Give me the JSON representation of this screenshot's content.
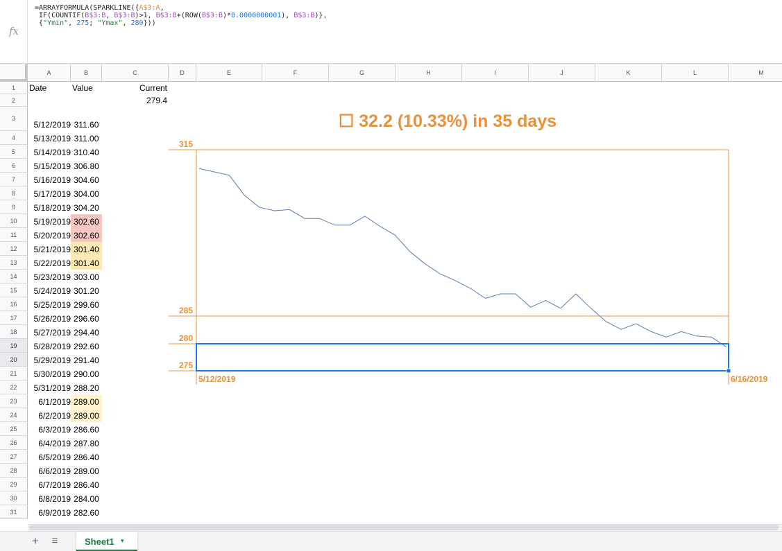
{
  "formula_bar": {
    "fx_label": "fx",
    "line1_prefix": "=ARRAYFORMULA(SPARKLINE({",
    "line1_ref": "A$3:A",
    "line1_suffix": ",",
    "line2_a": " IF(COUNTIF(",
    "line2_ref1": "B$3:B",
    "line2_b": ", ",
    "line2_ref2": "B$3:B",
    "line2_c": ")>1, ",
    "line2_ref3": "B$3:B",
    "line2_d": "+(ROW(",
    "line2_ref4": "B$3:B",
    "line2_e": ")*",
    "line2_num": "0.0000000001",
    "line2_f": "), ",
    "line2_ref5": "B$3:B",
    "line2_g": ")},",
    "line3_a": " {",
    "line3_s1": "\"Ymin\"",
    "line3_b": ", ",
    "line3_n1": "275",
    "line3_c": "; ",
    "line3_s2": "\"Ymax\"",
    "line3_d": ", ",
    "line3_n2": "280",
    "line3_e": "}))"
  },
  "columns": [
    "A",
    "B",
    "C",
    "D",
    "E",
    "F",
    "G",
    "H",
    "I",
    "J",
    "K",
    "L",
    "M"
  ],
  "headers": {
    "date": "Date",
    "value": "Value",
    "current": "Current"
  },
  "current_value": "279.4",
  "rows": [
    {
      "date": "5/12/2019",
      "value": "311.60",
      "hl": ""
    },
    {
      "date": "5/13/2019",
      "value": "311.00",
      "hl": ""
    },
    {
      "date": "5/14/2019",
      "value": "310.40",
      "hl": ""
    },
    {
      "date": "5/15/2019",
      "value": "306.80",
      "hl": ""
    },
    {
      "date": "5/16/2019",
      "value": "304.60",
      "hl": ""
    },
    {
      "date": "5/17/2019",
      "value": "304.00",
      "hl": ""
    },
    {
      "date": "5/18/2019",
      "value": "304.20",
      "hl": ""
    },
    {
      "date": "5/19/2019",
      "value": "302.60",
      "hl": "red"
    },
    {
      "date": "5/20/2019",
      "value": "302.60",
      "hl": "red"
    },
    {
      "date": "5/21/2019",
      "value": "301.40",
      "hl": "orange"
    },
    {
      "date": "5/22/2019",
      "value": "301.40",
      "hl": "orange"
    },
    {
      "date": "5/23/2019",
      "value": "303.00",
      "hl": ""
    },
    {
      "date": "5/24/2019",
      "value": "301.20",
      "hl": ""
    },
    {
      "date": "5/25/2019",
      "value": "299.60",
      "hl": ""
    },
    {
      "date": "5/26/2019",
      "value": "296.60",
      "hl": ""
    },
    {
      "date": "5/27/2019",
      "value": "294.40",
      "hl": ""
    },
    {
      "date": "5/28/2019",
      "value": "292.60",
      "hl": ""
    },
    {
      "date": "5/29/2019",
      "value": "291.40",
      "hl": ""
    },
    {
      "date": "5/30/2019",
      "value": "290.00",
      "hl": ""
    },
    {
      "date": "5/31/2019",
      "value": "288.20",
      "hl": ""
    },
    {
      "date": "6/1/2019",
      "value": "289.00",
      "hl": "yellow"
    },
    {
      "date": "6/2/2019",
      "value": "289.00",
      "hl": "yellow"
    },
    {
      "date": "6/3/2019",
      "value": "286.60",
      "hl": ""
    },
    {
      "date": "6/4/2019",
      "value": "287.80",
      "hl": ""
    },
    {
      "date": "6/5/2019",
      "value": "286.40",
      "hl": ""
    },
    {
      "date": "6/6/2019",
      "value": "289.00",
      "hl": ""
    },
    {
      "date": "6/7/2019",
      "value": "286.40",
      "hl": ""
    },
    {
      "date": "6/8/2019",
      "value": "284.00",
      "hl": ""
    },
    {
      "date": "6/9/2019",
      "value": "282.60",
      "hl": ""
    }
  ],
  "highlight_colors": {
    "red": "#f4c7c3",
    "orange": "#fce8b2",
    "yellow": "#fff2cc"
  },
  "chart": {
    "title": "☐ 32.2 (10.33%) in 35 days",
    "accent_color": "#e8913a",
    "line_color": "#5b7fa8",
    "selection_color": "#1a73e8"
  },
  "chart_data": {
    "type": "line",
    "title": "☐ 32.2 (10.33%) in 35 days",
    "x_tick_labels": [
      "5/12/2019",
      "6/16/2019"
    ],
    "y_tick_labels": [
      "315",
      "285",
      "280",
      "275"
    ],
    "y_segments": [
      {
        "from": 285,
        "to": 315
      },
      {
        "from": 280,
        "to": 285
      },
      {
        "from": 275,
        "to": 280
      }
    ],
    "x": [
      "5/12/2019",
      "5/13/2019",
      "5/14/2019",
      "5/15/2019",
      "5/16/2019",
      "5/17/2019",
      "5/18/2019",
      "5/19/2019",
      "5/20/2019",
      "5/21/2019",
      "5/22/2019",
      "5/23/2019",
      "5/24/2019",
      "5/25/2019",
      "5/26/2019",
      "5/27/2019",
      "5/28/2019",
      "5/29/2019",
      "5/30/2019",
      "5/31/2019",
      "6/1/2019",
      "6/2/2019",
      "6/3/2019",
      "6/4/2019",
      "6/5/2019",
      "6/6/2019",
      "6/7/2019",
      "6/8/2019",
      "6/9/2019",
      "6/10/2019",
      "6/11/2019",
      "6/12/2019",
      "6/13/2019",
      "6/14/2019",
      "6/15/2019",
      "6/16/2019"
    ],
    "values": [
      311.6,
      311.0,
      310.4,
      306.8,
      304.6,
      304.0,
      304.2,
      302.6,
      302.6,
      301.4,
      301.4,
      303.0,
      301.2,
      299.6,
      296.6,
      294.4,
      292.6,
      291.4,
      290.0,
      288.2,
      289.0,
      289.0,
      286.6,
      287.8,
      286.4,
      289.0,
      286.4,
      284.0,
      282.6,
      283.6,
      282.2,
      281.2,
      282.2,
      281.4,
      281.2,
      279.4
    ],
    "ymin": 275,
    "ymax": 315
  },
  "sheet_bar": {
    "add_icon": "+",
    "list_icon": "≡",
    "tab_label": "Sheet1",
    "tab_caret": "▾"
  }
}
